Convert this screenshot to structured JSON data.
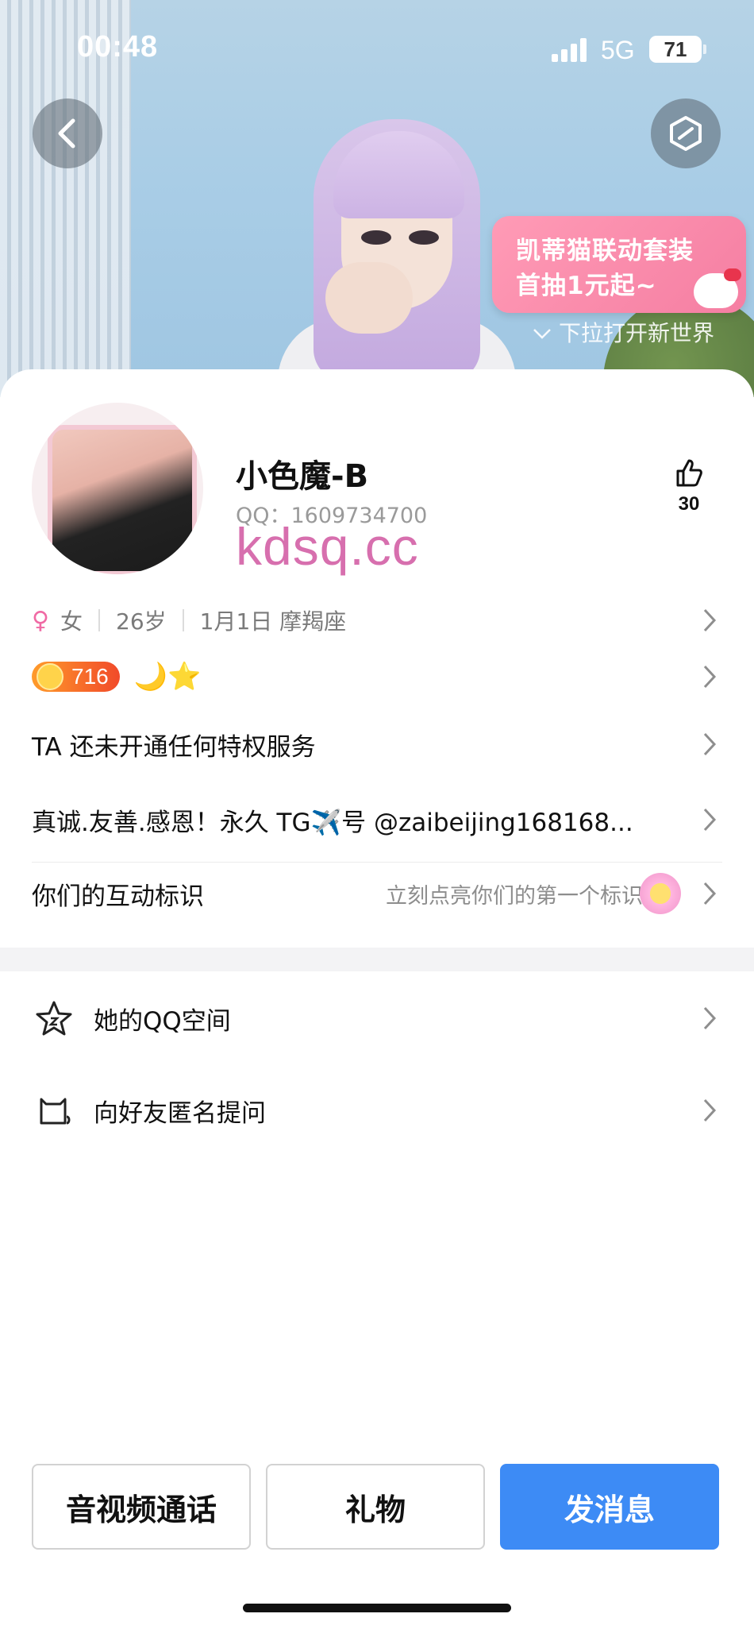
{
  "status_bar": {
    "time": "00:48",
    "network": "5G",
    "battery": "71"
  },
  "banner": {
    "promo_line1": "凯蒂猫联动套装",
    "promo_line2": "首抽1元起~",
    "pull_hint": "下拉打开新世界",
    "icons": [
      "back-icon",
      "cube-icon"
    ]
  },
  "profile": {
    "name": "小色魔-B",
    "qq": "QQ：1609734700",
    "watermark": "kdsq.cc",
    "likes": "30",
    "gender": "女",
    "age": "26岁",
    "birthday": "1月1日 摩羯座",
    "level": "716",
    "level_icons": "🌙⭐"
  },
  "rows": {
    "privilege": "TA 还未开通任何特权服务",
    "signature": "真诚.友善.感恩！永久 TG✈️号 @zaibeijing168168...",
    "interact_label": "你们的互动标识",
    "interact_hint": "立刻点亮你们的第一个标识"
  },
  "menu": {
    "qzone": "她的QQ空间",
    "ask": "向好友匿名提问"
  },
  "actions": {
    "call": "音视频通话",
    "gift": "礼物",
    "message": "发消息"
  },
  "colors": {
    "accent": "#3d8bf5",
    "female": "#f06aa4",
    "promo": "#f57ea2",
    "watermark": "#d76fae"
  }
}
